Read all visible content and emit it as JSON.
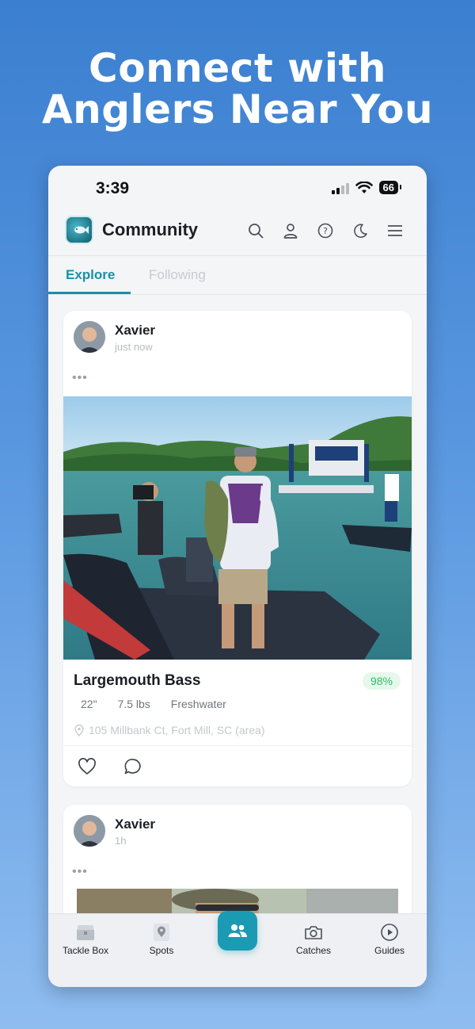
{
  "headline": {
    "line1": "Connect with",
    "line2": "Anglers Near You"
  },
  "status": {
    "time": "3:39",
    "battery": "66"
  },
  "app": {
    "title": "Community"
  },
  "tabs": [
    {
      "label": "Explore"
    },
    {
      "label": "Following"
    }
  ],
  "posts": [
    {
      "user": "Xavier",
      "time": "just now",
      "more": "•••",
      "species": "Largemouth Bass",
      "confidence": "98%",
      "length": "22\"",
      "weight": "7.5 lbs",
      "water": "Freshwater",
      "location": "105 Millbank Ct, Fort Mill, SC (area)"
    },
    {
      "user": "Xavier",
      "time": "1h",
      "more": "•••"
    }
  ],
  "nav": [
    {
      "label": "Tackle Box",
      "icon": "tackle-box-icon"
    },
    {
      "label": "Spots",
      "icon": "map-pin-icon"
    },
    {
      "label": "",
      "icon": "community-icon"
    },
    {
      "label": "Catches",
      "icon": "camera-icon"
    },
    {
      "label": "Guides",
      "icon": "play-icon"
    }
  ],
  "colors": {
    "accent": "#1a8fa8",
    "background": "#3b7fd0",
    "confidence": "#2fbf64"
  }
}
